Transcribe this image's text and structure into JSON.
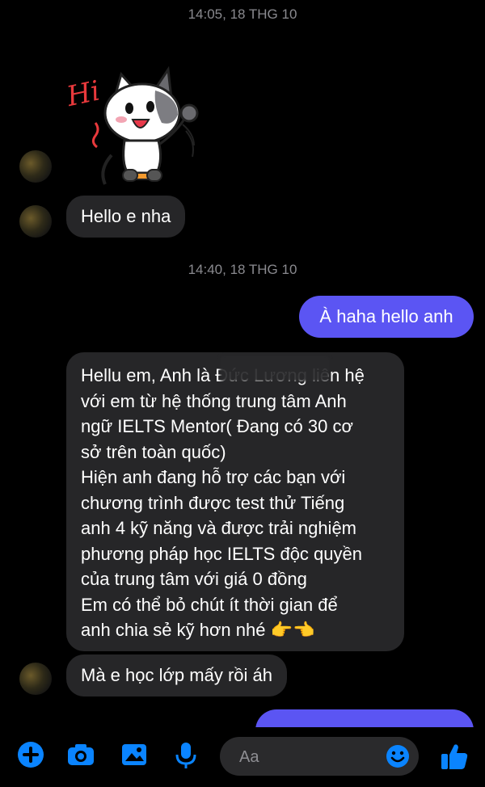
{
  "messages": {
    "time_1": "14:05, 18 THG 10",
    "msg_hello": "Hello e nha",
    "time_2": "14:40, 18 THG 10",
    "msg_out_1": "À haha hello anh",
    "msg_long": "Hellu em, Anh là Đức Lương liên hệ\nvới em từ hệ thống trung tâm Anh\nngữ IELTS Mentor( Đang có 30 cơ\nsở trên toàn quốc)\nHiện anh đang hỗ trợ các bạn với\nchương trình được test thử Tiếng\nanh 4 kỹ năng và được trải nghiệm\nphương pháp học IELTS độc quyền\ncủa trung tâm với giá 0 đồng\nEm có thể bỏ chút ít thời gian để\nanh chia sẻ kỹ hơn nhé 👉👈",
    "msg_grade": "Mà e học lớp mấy rồi áh",
    "sticker_text": "Hi"
  },
  "composer": {
    "placeholder": "Aa"
  },
  "colors": {
    "outgoing_bubble": "#5b55f3",
    "incoming_bubble": "#262628",
    "accent": "#0a84ff"
  },
  "icons": [
    "plus-icon",
    "camera-icon",
    "image-icon",
    "microphone-icon",
    "emoji-icon",
    "thumbs-up-icon"
  ]
}
